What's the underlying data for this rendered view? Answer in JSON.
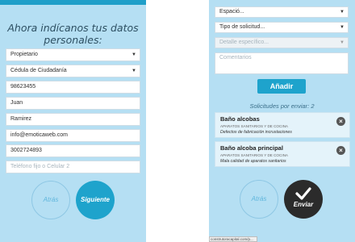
{
  "left_panel": {
    "heading_line1": "Ahora indícanos tus datos",
    "heading_line2": "personales:",
    "relationship_select": "Propietario",
    "document_type_select": "Cédula de Ciudadanía",
    "document_number": "98623455",
    "first_name": "Juan",
    "last_name": "Ramirez",
    "email": "info@emoticaweb.com",
    "mobile": "3002724893",
    "phone_placeholder": "Teléfono fijo o Celular 2",
    "back_label": "Atrás",
    "next_label": "Siguiente"
  },
  "right_panel": {
    "space_select": "Espació...",
    "request_type_select": "Tipo de solicitud...",
    "detail_select": "Detalle específico...",
    "comments_placeholder": "Comentarios",
    "add_label": "Añadir",
    "pending_label": "Solicitudes por enviar: 2",
    "requests": [
      {
        "title": "Baño alcobas",
        "category": "APARATOS SANITARIOS Y DE COCINA",
        "description": "Defectos de fabricación incrustaciones"
      },
      {
        "title": "Baño alcoba principal",
        "category": "APARATOS SANITARIOS Y DE COCINA",
        "description": "Mala calidad de aparatos sanitarios"
      }
    ],
    "back_label": "Atrás",
    "send_label": "Enviar"
  },
  "status_bar": {
    "url": "construtoracapital.com/p..."
  },
  "icons": {
    "dropdown": "chevron-down-icon",
    "remove": "close-icon",
    "send": "checkmark-icon"
  },
  "colors": {
    "panel_bg": "#b5dff3",
    "accent": "#1ea3cc",
    "send_button": "#2b2b2b"
  }
}
